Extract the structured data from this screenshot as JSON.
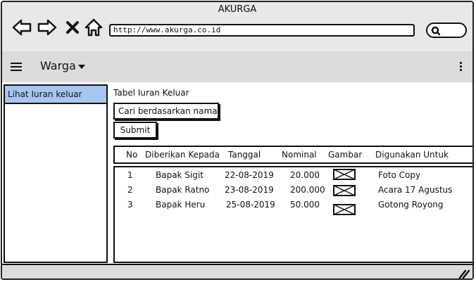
{
  "window": {
    "title": "AKURGA"
  },
  "browser": {
    "url": "http://www.akurga.co.id"
  },
  "menu": {
    "title": "Warga"
  },
  "sidebar": {
    "items": [
      {
        "label": "Lihat Iuran keluar"
      }
    ]
  },
  "content": {
    "heading": "Tabel Iuran Keluar",
    "search_placeholder": "Cari berdasarkan nama",
    "submit_label": "Submit"
  },
  "table": {
    "columns": [
      "No",
      "Diberikan Kepada",
      "Tanggal",
      "Nominal",
      "Gambar",
      "Digunakan Untuk"
    ],
    "rows": [
      {
        "no": "1",
        "diberikan_kepada": "Bapak Sigit",
        "tanggal": "22-08-2019",
        "nominal": "20.000",
        "digunakan_untuk": "Foto Copy"
      },
      {
        "no": "2",
        "diberikan_kepada": "Bapak Ratno",
        "tanggal": "23-08-2019",
        "nominal": "200.000",
        "digunakan_untuk": "Acara 17 Agustus"
      },
      {
        "no": "3",
        "diberikan_kepada": "Bapak Heru",
        "tanggal": "25-08-2019",
        "nominal": "50.000",
        "digunakan_untuk": "Gotong Royong"
      }
    ]
  },
  "icons": {
    "back": "arrow-left-icon",
    "forward": "arrow-right-icon",
    "stop": "close-icon",
    "home": "home-icon",
    "search": "search-icon",
    "menu": "hamburger-icon",
    "more": "kebab-menu-icon",
    "image": "image-placeholder-icon",
    "resize": "resize-grip-icon"
  },
  "colors": {
    "selected_item": "#a7c7f2",
    "chrome": "#e8e8e8"
  }
}
